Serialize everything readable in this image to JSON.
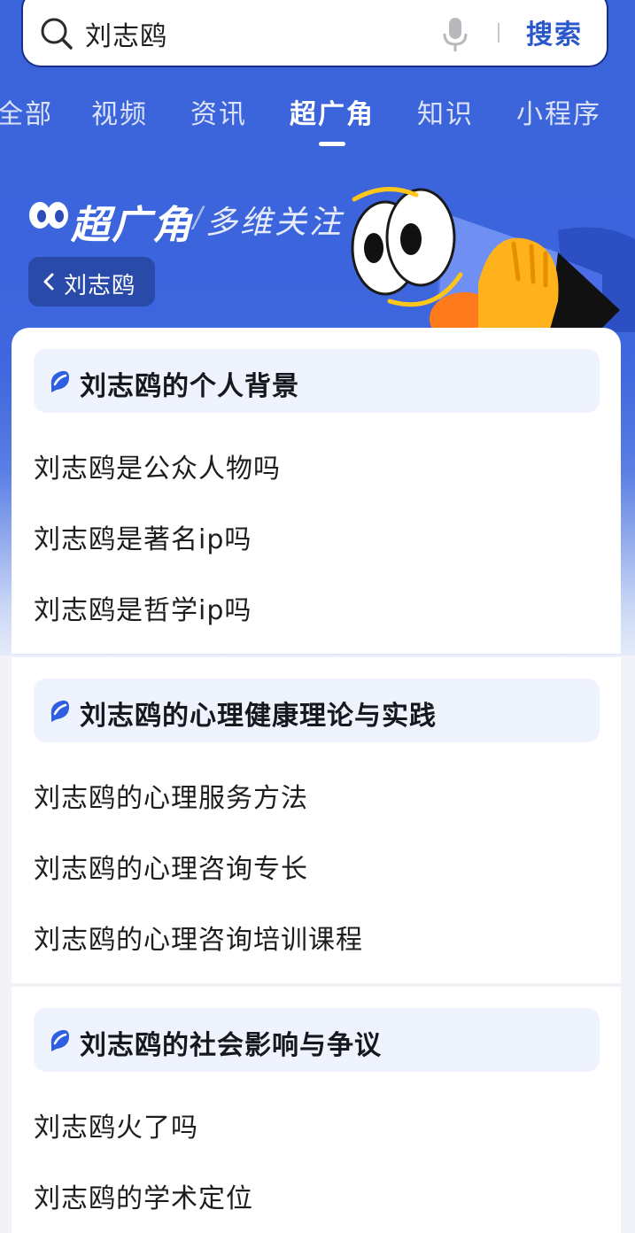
{
  "search": {
    "query": "刘志鸥",
    "button_label": "搜索"
  },
  "tabs": [
    {
      "label": "全部"
    },
    {
      "label": "视频"
    },
    {
      "label": "资讯"
    },
    {
      "label": "超广角"
    },
    {
      "label": "知识"
    },
    {
      "label": "小程序"
    }
  ],
  "active_tab": "超广角",
  "banner": {
    "title": "超广角",
    "separator": "/",
    "subtitle": "多维关注",
    "back_label": "刘志鸥"
  },
  "sections": [
    {
      "title": "刘志鸥的个人背景",
      "items": [
        "刘志鸥是公众人物吗",
        "刘志鸥是著名ip吗",
        "刘志鸥是哲学ip吗"
      ]
    },
    {
      "title": "刘志鸥的心理健康理论与实践",
      "items": [
        "刘志鸥的心理服务方法",
        "刘志鸥的心理咨询专长",
        "刘志鸥的心理咨询培训课程"
      ]
    },
    {
      "title": "刘志鸥的社会影响与争议",
      "items": [
        "刘志鸥火了吗",
        "刘志鸥的学术定位"
      ]
    }
  ],
  "icons": {
    "search": "search-icon",
    "mic": "microphone-icon",
    "back": "chevron-left-icon",
    "section": "leaf-bubble-icon",
    "mascot": "megaphone-eyes-mascot"
  },
  "colors": {
    "brand_blue": "#3b63da",
    "search_text": "#2a57c9",
    "header_bg": "#eef3fd",
    "section_icon": "#2f5fe0"
  }
}
